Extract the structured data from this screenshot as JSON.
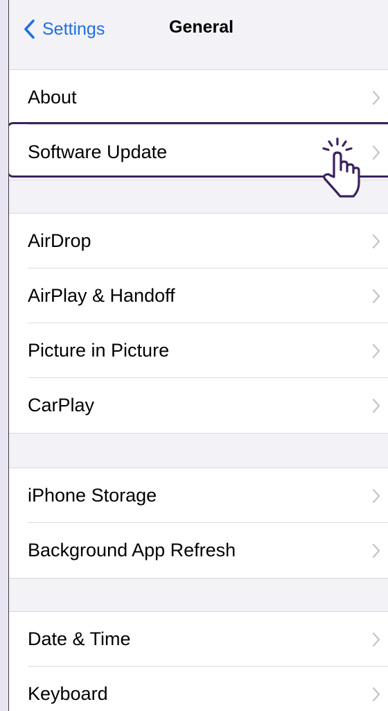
{
  "navbar": {
    "back_label": "Settings",
    "title": "General"
  },
  "groups": [
    {
      "rows": [
        {
          "label": "About"
        },
        {
          "label": "Software Update"
        }
      ]
    },
    {
      "rows": [
        {
          "label": "AirDrop"
        },
        {
          "label": "AirPlay & Handoff"
        },
        {
          "label": "Picture in Picture"
        },
        {
          "label": "CarPlay"
        }
      ]
    },
    {
      "rows": [
        {
          "label": "iPhone Storage"
        },
        {
          "label": "Background App Refresh"
        }
      ]
    },
    {
      "rows": [
        {
          "label": "Date & Time"
        },
        {
          "label": "Keyboard"
        }
      ]
    }
  ],
  "highlighted_row": "Software Update",
  "icons": {
    "back": "chevron-left-icon",
    "row_disclosure": "chevron-right-icon",
    "tap_indicator": "hand-tap-icon"
  },
  "colors": {
    "accent": "#1f6fe5",
    "highlight": "#3b2160",
    "background": "#f2f2f7",
    "row_background": "#ffffff"
  }
}
